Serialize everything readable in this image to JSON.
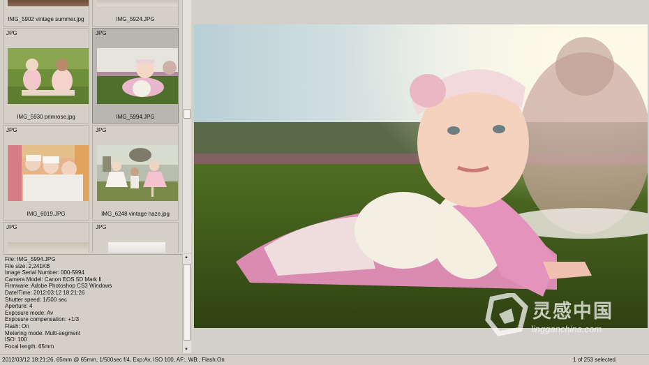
{
  "thumbnails": [
    {
      "type": "",
      "name": "IMG_5902 vintage summer.jpg"
    },
    {
      "type": "",
      "name": "IMG_5924.JPG"
    },
    {
      "type": "JPG",
      "name": "IMG_5930 primrose.jpg"
    },
    {
      "type": "JPG",
      "name": "IMG_5994.JPG"
    },
    {
      "type": "JPG",
      "name": "IMG_6019.JPG"
    },
    {
      "type": "JPG",
      "name": "IMG_6248 vintage haze.jpg"
    },
    {
      "type": "JPG",
      "name": ""
    },
    {
      "type": "JPG",
      "name": ""
    }
  ],
  "info_lines": [
    "File: IMG_5994.JPG",
    "File size: 2,241KB",
    "Image Serial Number: 000-5994",
    "Camera Model: Canon EOS 5D Mark II",
    "Firmware: Adobe Photoshop CS3 Windows",
    "Date/Time: 2012:03:12 18:21:26",
    "Shutter speed: 1/500 sec",
    "Aperture: 4",
    "Exposure mode: Av",
    "Exposure compensation: +1/3",
    "Flash: On",
    "Metering mode: Multi-segment",
    "ISO: 100",
    "Focal length: 65mm"
  ],
  "status": {
    "left": "2012/03/12 18:21:26, 65mm @ 65mm, 1/500sec f/4, Exp:Av, ISO 100, AF:, WB:, Flash:On",
    "right": "1 of 253 selected"
  },
  "watermark": {
    "brand": "灵感中国",
    "url": "lingganchina.com"
  }
}
